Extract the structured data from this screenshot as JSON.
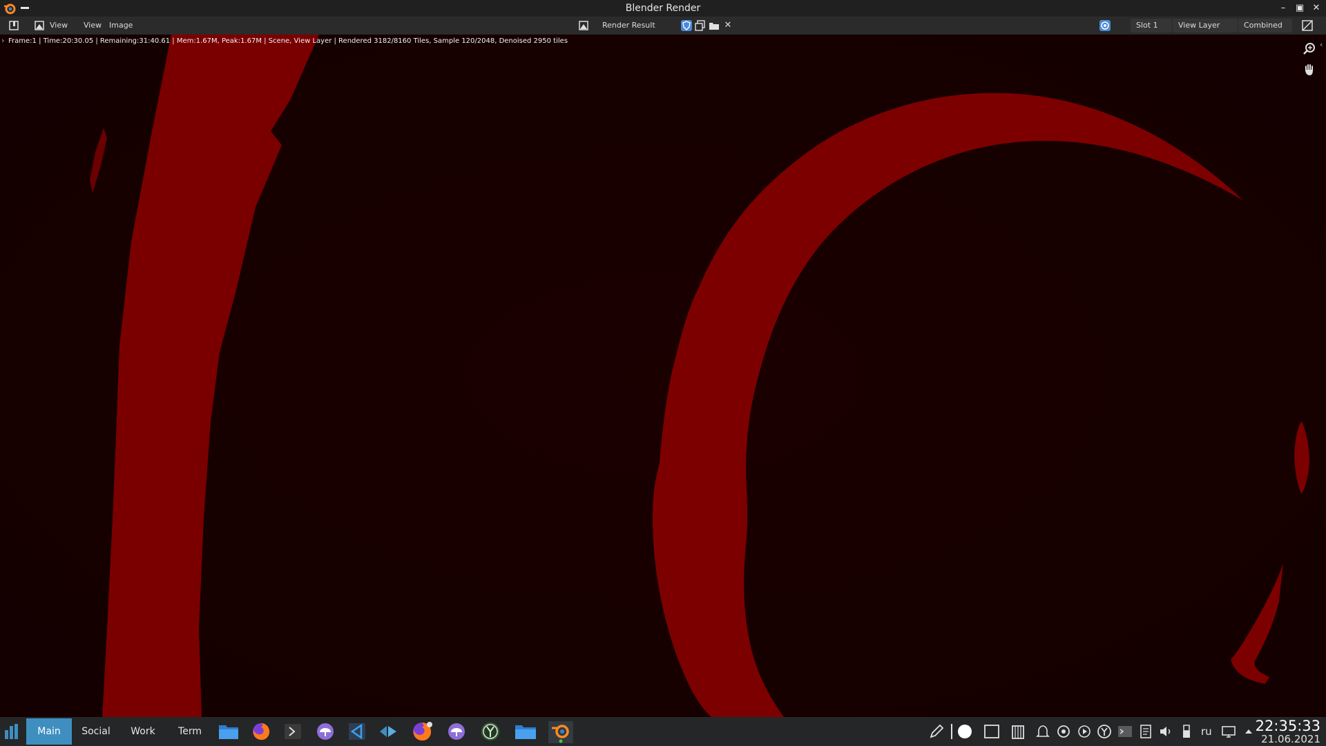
{
  "window": {
    "title": "Blender Render"
  },
  "header": {
    "editor_menu_view": "View",
    "menu_view": "View",
    "menu_image": "Image",
    "image_name": "Render Result",
    "slot": "Slot 1",
    "view_layer": "View Layer",
    "pass": "Combined"
  },
  "render": {
    "stats": "Frame:1 | Time:20:30.05 | Remaining:31:40.61 | Mem:1.67M, Peak:1.67M | Scene, View Layer | Rendered 3182/8160 Tiles, Sample 120/2048, Denoised 2950 tiles",
    "colors": {
      "background": "#1a0001",
      "shape": "#7d0000"
    }
  },
  "taskbar": {
    "desktops": [
      "Main",
      "Social",
      "Work",
      "Term"
    ],
    "active_desktop": "Main",
    "apps": [
      "file-manager-icon",
      "firefox-icon",
      "terminal-icon",
      "cloud-icon",
      "vscode-icon",
      "kdeconnect-icon",
      "firefox-icon",
      "cloud-icon",
      "yggdrasil-icon",
      "file-manager-icon",
      "blender-icon"
    ],
    "tray": [
      "pen-icon",
      "circle-icon",
      "window-icon",
      "clipboard-icon",
      "bell-icon",
      "vpn-icon",
      "media-icon",
      "yggdrasil-icon",
      "console-icon",
      "notes-icon",
      "volume-icon",
      "usb-icon",
      "network-icon",
      "expand-arrow-icon"
    ],
    "keyboard_layout": "ru",
    "time": "22:35:33",
    "date": "21.06.2021",
    "accent": "#3e8fc0"
  }
}
